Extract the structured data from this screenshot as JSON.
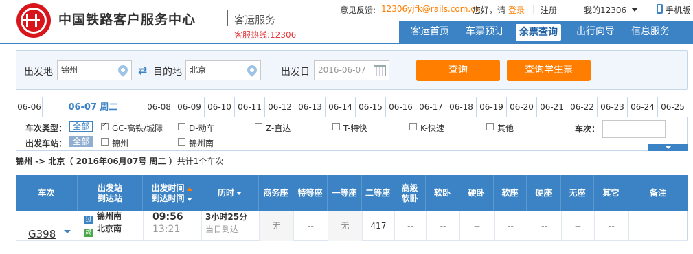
{
  "header": {
    "site_title": "中国铁路客户服务中心",
    "subtitle": "客运服务",
    "hotline": "客服热线:12306",
    "feedback_label": "意见反馈:",
    "feedback_email": "12306yjfk@rails.com.cn",
    "greeting": "您好，请",
    "login": "登录",
    "sep": "|",
    "register": "注册",
    "my12306": "我的12306",
    "mobile": "手机版"
  },
  "nav": {
    "items": [
      "客运首页",
      "车票预订",
      "余票查询",
      "出行向导",
      "信息服务"
    ],
    "active": "余票查询"
  },
  "query": {
    "from_label": "出发地",
    "from_value": "锦州",
    "to_label": "目的地",
    "to_value": "北京",
    "date_label": "出发日",
    "date_value": "2016-06-07",
    "search_button": "查询",
    "student_button": "查询学生票"
  },
  "dates": [
    "06-06",
    "06-07 周二",
    "06-08",
    "06-09",
    "06-10",
    "06-11",
    "06-12",
    "06-13",
    "06-14",
    "06-15",
    "06-16",
    "06-17",
    "06-18",
    "06-19",
    "06-20",
    "06-21",
    "06-22",
    "06-23",
    "06-24",
    "06-25"
  ],
  "filters": {
    "type_label": "车次类型：",
    "station_label": "出发车站：",
    "all": "全部",
    "types": [
      {
        "label": "GC-高铁/城际",
        "checked": true
      },
      {
        "label": "D-动车",
        "checked": false
      },
      {
        "label": "Z-直达",
        "checked": false
      },
      {
        "label": "T-特快",
        "checked": false
      },
      {
        "label": "K-快速",
        "checked": false
      },
      {
        "label": "其他",
        "checked": false
      }
    ],
    "stations": [
      {
        "label": "锦州",
        "checked": false
      },
      {
        "label": "锦州南",
        "checked": false
      }
    ],
    "train_no_label": "车次："
  },
  "summary": {
    "route": "锦州 -> 北京",
    "date": "（ 2016年06月07号  周二 ）",
    "count": "共计1个车次"
  },
  "table": {
    "headers": {
      "train": "车次",
      "station_from": "出发站",
      "station_to": "到达站",
      "time_depart": "出发时间",
      "time_arrive": "到达时间",
      "duration": "历时",
      "business": "商务座",
      "premium": "特等座",
      "first": "一等座",
      "second": "二等座",
      "deluxe_soft_a": "高级",
      "deluxe_soft_b": "软卧",
      "soft_sleeper": "软卧",
      "hard_sleeper": "硬卧",
      "soft_seat": "软座",
      "hard_seat": "硬座",
      "no_seat": "无座",
      "other": "其它",
      "remarks": "备注"
    },
    "rows": [
      {
        "train": "G398",
        "from_badge": "过",
        "from": "锦州南",
        "to_badge": "终",
        "to": "北京南",
        "depart": "09:56",
        "arrive": "13:21",
        "duration": "3小时25分",
        "arrival_day": "当日到达",
        "business": "无",
        "premium": "--",
        "first": "无",
        "second": "417",
        "deluxe": "--",
        "soft_sleeper": "--",
        "hard_sleeper": "--",
        "soft_seat": "--",
        "hard_seat": "--",
        "no_seat": "--",
        "other": "--",
        "remarks": ""
      }
    ]
  },
  "colors": {
    "brand_red": "#d8151a",
    "nav_blue": "#3b83c4",
    "orange": "#ff7e00"
  }
}
